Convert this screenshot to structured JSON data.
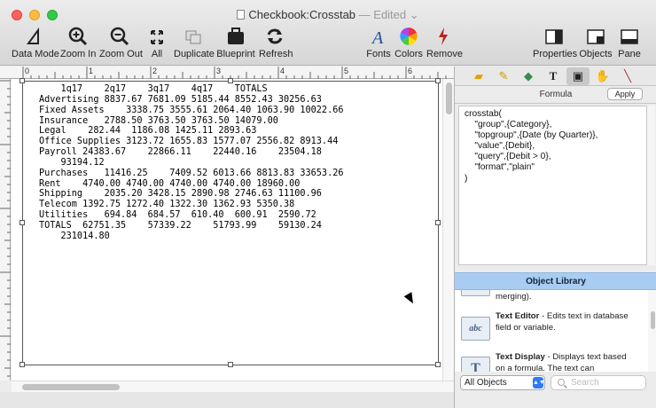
{
  "window": {
    "title": "Checkbook:Crosstab",
    "edited": "— Edited ⌄"
  },
  "toolbar": {
    "data_mode": "Data Mode",
    "zoom_in": "Zoom In",
    "zoom_out": "Zoom Out",
    "all": "All",
    "duplicate": "Duplicate",
    "blueprint": "Blueprint",
    "refresh": "Refresh",
    "fonts": "Fonts",
    "colors": "Colors",
    "remove": "Remove",
    "properties": "Properties",
    "objects": "Objects",
    "pane": "Pane"
  },
  "ruler": {
    "marks": [
      "0",
      "1",
      "2",
      "3",
      "4",
      "5",
      "6"
    ]
  },
  "crosstab": {
    "lines": [
      "    1q17    2q17    3q17    4q17    TOTALS",
      "Advertising 8837.67 7681.09 5185.44 8552.43 30256.63",
      "Fixed Assets    3338.75 3555.61 2064.40 1063.90 10022.66",
      "Insurance   2788.50 3763.50 3763.50 14079.00",
      "Legal    282.44  1186.08 1425.11 2893.63",
      "Office Supplies 3123.72 1655.83 1577.07 2556.82 8913.44",
      "Payroll 24383.67    22866.11    22440.16    23504.18",
      "    93194.12",
      "Purchases   11416.25    7409.52 6013.66 8813.83 33653.26",
      "Rent    4740.00 4740.00 4740.00 4740.00 18960.00",
      "Shipping    2035.20 3428.15 2890.98 2746.63 11100.96",
      "Telecom 1392.75 1272.40 1322.30 1362.93 5350.38",
      "Utilities   694.84  684.57  610.40  600.91  2590.72",
      "TOTALS  62751.35    57339.22    51793.99    59130.24",
      "    231014.80"
    ]
  },
  "side": {
    "formula_title": "Formula",
    "apply": "Apply",
    "formula_text": "crosstab(\n    \"group\",{Category},\n    \"topgroup\",{Date (by Quarter)},\n    \"value\",{Debit},\n    \"query\",{Debit > 0},\n    \"format\",\"plain\"\n)",
    "object_library": "Object Library",
    "partial_item": "merging).",
    "items": [
      {
        "icon": "abc",
        "name": "Text Editor",
        "desc": " - Edits text in database field or variable."
      },
      {
        "icon": "T",
        "name": "Text Display",
        "desc": " - Displays text based on a formula. The text can"
      }
    ],
    "filter": "All Objects",
    "search_placeholder": "Search"
  }
}
